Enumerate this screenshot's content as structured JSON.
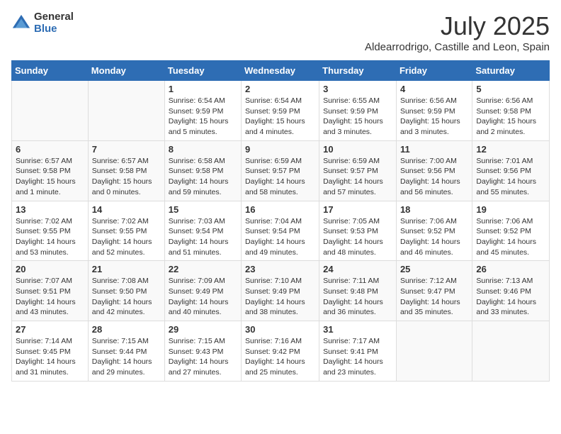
{
  "header": {
    "logo_general": "General",
    "logo_blue": "Blue",
    "month_title": "July 2025",
    "location": "Aldearrodrigo, Castille and Leon, Spain"
  },
  "days_of_week": [
    "Sunday",
    "Monday",
    "Tuesday",
    "Wednesday",
    "Thursday",
    "Friday",
    "Saturday"
  ],
  "weeks": [
    [
      {
        "day": "",
        "info": ""
      },
      {
        "day": "",
        "info": ""
      },
      {
        "day": "1",
        "info": "Sunrise: 6:54 AM\nSunset: 9:59 PM\nDaylight: 15 hours and 5 minutes."
      },
      {
        "day": "2",
        "info": "Sunrise: 6:54 AM\nSunset: 9:59 PM\nDaylight: 15 hours and 4 minutes."
      },
      {
        "day": "3",
        "info": "Sunrise: 6:55 AM\nSunset: 9:59 PM\nDaylight: 15 hours and 3 minutes."
      },
      {
        "day": "4",
        "info": "Sunrise: 6:56 AM\nSunset: 9:59 PM\nDaylight: 15 hours and 3 minutes."
      },
      {
        "day": "5",
        "info": "Sunrise: 6:56 AM\nSunset: 9:58 PM\nDaylight: 15 hours and 2 minutes."
      }
    ],
    [
      {
        "day": "6",
        "info": "Sunrise: 6:57 AM\nSunset: 9:58 PM\nDaylight: 15 hours and 1 minute."
      },
      {
        "day": "7",
        "info": "Sunrise: 6:57 AM\nSunset: 9:58 PM\nDaylight: 15 hours and 0 minutes."
      },
      {
        "day": "8",
        "info": "Sunrise: 6:58 AM\nSunset: 9:58 PM\nDaylight: 14 hours and 59 minutes."
      },
      {
        "day": "9",
        "info": "Sunrise: 6:59 AM\nSunset: 9:57 PM\nDaylight: 14 hours and 58 minutes."
      },
      {
        "day": "10",
        "info": "Sunrise: 6:59 AM\nSunset: 9:57 PM\nDaylight: 14 hours and 57 minutes."
      },
      {
        "day": "11",
        "info": "Sunrise: 7:00 AM\nSunset: 9:56 PM\nDaylight: 14 hours and 56 minutes."
      },
      {
        "day": "12",
        "info": "Sunrise: 7:01 AM\nSunset: 9:56 PM\nDaylight: 14 hours and 55 minutes."
      }
    ],
    [
      {
        "day": "13",
        "info": "Sunrise: 7:02 AM\nSunset: 9:55 PM\nDaylight: 14 hours and 53 minutes."
      },
      {
        "day": "14",
        "info": "Sunrise: 7:02 AM\nSunset: 9:55 PM\nDaylight: 14 hours and 52 minutes."
      },
      {
        "day": "15",
        "info": "Sunrise: 7:03 AM\nSunset: 9:54 PM\nDaylight: 14 hours and 51 minutes."
      },
      {
        "day": "16",
        "info": "Sunrise: 7:04 AM\nSunset: 9:54 PM\nDaylight: 14 hours and 49 minutes."
      },
      {
        "day": "17",
        "info": "Sunrise: 7:05 AM\nSunset: 9:53 PM\nDaylight: 14 hours and 48 minutes."
      },
      {
        "day": "18",
        "info": "Sunrise: 7:06 AM\nSunset: 9:52 PM\nDaylight: 14 hours and 46 minutes."
      },
      {
        "day": "19",
        "info": "Sunrise: 7:06 AM\nSunset: 9:52 PM\nDaylight: 14 hours and 45 minutes."
      }
    ],
    [
      {
        "day": "20",
        "info": "Sunrise: 7:07 AM\nSunset: 9:51 PM\nDaylight: 14 hours and 43 minutes."
      },
      {
        "day": "21",
        "info": "Sunrise: 7:08 AM\nSunset: 9:50 PM\nDaylight: 14 hours and 42 minutes."
      },
      {
        "day": "22",
        "info": "Sunrise: 7:09 AM\nSunset: 9:49 PM\nDaylight: 14 hours and 40 minutes."
      },
      {
        "day": "23",
        "info": "Sunrise: 7:10 AM\nSunset: 9:49 PM\nDaylight: 14 hours and 38 minutes."
      },
      {
        "day": "24",
        "info": "Sunrise: 7:11 AM\nSunset: 9:48 PM\nDaylight: 14 hours and 36 minutes."
      },
      {
        "day": "25",
        "info": "Sunrise: 7:12 AM\nSunset: 9:47 PM\nDaylight: 14 hours and 35 minutes."
      },
      {
        "day": "26",
        "info": "Sunrise: 7:13 AM\nSunset: 9:46 PM\nDaylight: 14 hours and 33 minutes."
      }
    ],
    [
      {
        "day": "27",
        "info": "Sunrise: 7:14 AM\nSunset: 9:45 PM\nDaylight: 14 hours and 31 minutes."
      },
      {
        "day": "28",
        "info": "Sunrise: 7:15 AM\nSunset: 9:44 PM\nDaylight: 14 hours and 29 minutes."
      },
      {
        "day": "29",
        "info": "Sunrise: 7:15 AM\nSunset: 9:43 PM\nDaylight: 14 hours and 27 minutes."
      },
      {
        "day": "30",
        "info": "Sunrise: 7:16 AM\nSunset: 9:42 PM\nDaylight: 14 hours and 25 minutes."
      },
      {
        "day": "31",
        "info": "Sunrise: 7:17 AM\nSunset: 9:41 PM\nDaylight: 14 hours and 23 minutes."
      },
      {
        "day": "",
        "info": ""
      },
      {
        "day": "",
        "info": ""
      }
    ]
  ]
}
